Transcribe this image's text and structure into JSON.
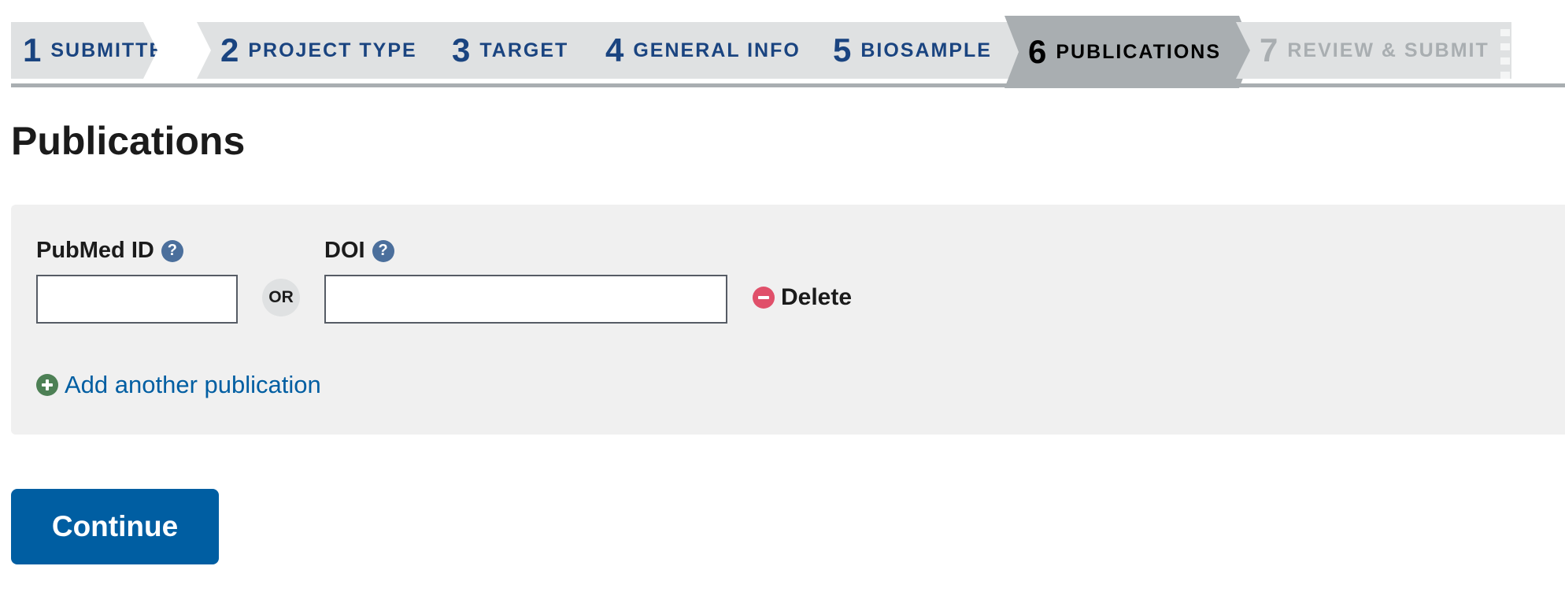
{
  "steps": [
    {
      "number": "1",
      "label": "SUBMITTER",
      "state": "complete"
    },
    {
      "number": "2",
      "label": "PROJECT TYPE",
      "state": "complete"
    },
    {
      "number": "3",
      "label": "TARGET",
      "state": "complete"
    },
    {
      "number": "4",
      "label": "GENERAL INFO",
      "state": "complete"
    },
    {
      "number": "5",
      "label": "BIOSAMPLE",
      "state": "complete"
    },
    {
      "number": "6",
      "label": "PUBLICATIONS",
      "state": "current"
    },
    {
      "number": "7",
      "label": "REVIEW & SUBMIT",
      "state": "upcoming"
    }
  ],
  "page": {
    "title": "Publications"
  },
  "publication": {
    "pubmed_label": "PubMed ID",
    "pubmed_value": "",
    "or_text": "OR",
    "doi_label": "DOI",
    "doi_value": "",
    "help_glyph": "?",
    "delete_label": "Delete",
    "add_label": "Add another publication"
  },
  "actions": {
    "continue_label": "Continue"
  },
  "icons": {
    "help": "question-circle-icon",
    "delete": "minus-circle-icon",
    "add": "plus-circle-icon"
  },
  "colors": {
    "primary": "#005ea2",
    "step_text": "#1a4480",
    "step_bg": "#dfe1e2",
    "step_current_bg": "#a9aeb1",
    "help_icon": "#4b6f9c",
    "delete_icon": "#e0506a",
    "add_icon": "#4d8055",
    "panel_bg": "#f0f0f0"
  }
}
